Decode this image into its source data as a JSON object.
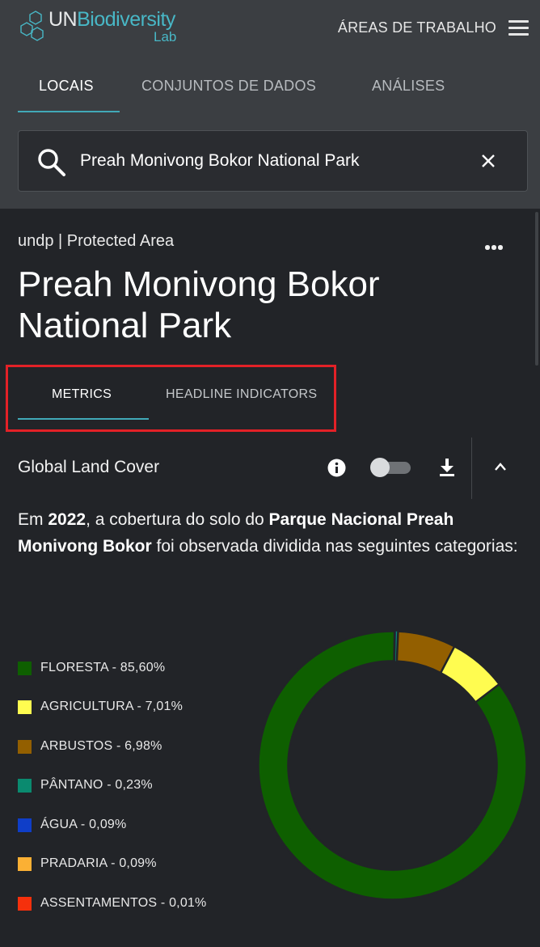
{
  "header": {
    "logo": {
      "un": "UN",
      "biodiversity": "Biodiversity",
      "lab": "Lab"
    },
    "workspaces_label": "ÁREAS DE TRABALHO",
    "menu_icon": "hamburger-menu-icon"
  },
  "nav": {
    "tabs": [
      {
        "label": "LOCAIS",
        "active": true
      },
      {
        "label": "CONJUNTOS DE DADOS",
        "active": false
      },
      {
        "label": "ANÁLISES",
        "active": false
      }
    ]
  },
  "search": {
    "value": "Preah Monivong Bokor National Park",
    "icon": "search-icon",
    "clear_icon": "close-icon"
  },
  "place": {
    "subtitle": "undp | Protected Area",
    "title": "Preah Monivong Bokor National Park",
    "more_icon": "more-horizontal-icon"
  },
  "subtabs": [
    {
      "label": "METRICS",
      "active": true
    },
    {
      "label": "HEADLINE INDICATORS",
      "active": false
    }
  ],
  "section": {
    "title": "Global Land Cover",
    "toggle_on": false,
    "icons": [
      "info-icon",
      "toggle-switch",
      "download-icon",
      "chevron-up-icon"
    ]
  },
  "description": {
    "part1": "Em ",
    "year": "2022",
    "part2": ", a cobertura do solo do ",
    "place_name": "Parque Nacional Preah Monivong Bokor",
    "part3": " foi observada dividida nas seguintes categorias:"
  },
  "colors": {
    "accent": "#41a9b8",
    "highlight": "#e32127"
  },
  "chart_data": {
    "type": "pie",
    "style": "donut",
    "legend_position": "left",
    "categories": [
      "FLORESTA",
      "AGRICULTURA",
      "ARBUSTOS",
      "PÂNTANO",
      "ÁGUA",
      "PRADARIA",
      "ASSENTAMENTOS"
    ],
    "values": [
      85.6,
      7.01,
      6.98,
      0.23,
      0.09,
      0.09,
      0.01
    ],
    "labels": [
      "FLORESTA - 85,60%",
      "AGRICULTURA - 7,01%",
      "ARBUSTOS - 6,98%",
      "PÂNTANO - 0,23%",
      "ÁGUA - 0,09%",
      "PRADARIA - 0,09%",
      "ASSENTAMENTOS - 0,01%"
    ],
    "colors": [
      "#0e5f00",
      "#fffc50",
      "#935f00",
      "#0a8a6f",
      "#0f3ec8",
      "#fbb034",
      "#f5300c"
    ]
  }
}
